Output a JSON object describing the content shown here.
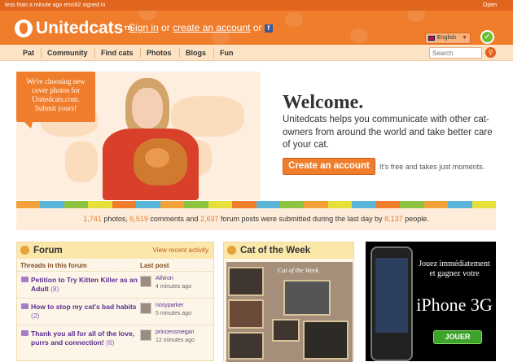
{
  "topstrip": {
    "status": "less than a minute ago",
    "user": "ems92",
    "signed": "signed in",
    "open": "Open"
  },
  "header": {
    "logo": "Unitedcats",
    "logo_tm": "TM",
    "signin": "Sign in",
    "or1": "or",
    "create": "create an account",
    "or2": "or",
    "language": "English"
  },
  "nav": {
    "items": [
      "Pat",
      "Community",
      "Find cats",
      "Photos",
      "Blogs",
      "Fun"
    ],
    "search_placeholder": "Search"
  },
  "hero": {
    "bubble": "We're choosing new cover photos for Unitedcats.com. Submit yours!",
    "welcome": "Welcome.",
    "intro": "Unitedcats helps you communicate with other cat-owners from around the world and take better care of your cat.",
    "cta": "Create an account",
    "cta_note": "It's free and takes just moments."
  },
  "stats": {
    "photos": "1,741",
    "photos_label": "photos,",
    "comments": "6,519",
    "comments_label": "comments and",
    "posts": "2,637",
    "posts_label": "forum posts were submitted during the last day by",
    "people": "8,137",
    "people_label": "people."
  },
  "forum": {
    "title": "Forum",
    "recent": "View recent activity",
    "col_threads": "Threads in this forum",
    "col_last": "Last post",
    "threads": [
      {
        "title": "Petition to Try Kitten Killer as an Adult",
        "count": "(8)",
        "user": "Alhiron",
        "time": "4 minutes ago"
      },
      {
        "title": "How to stop my cat's bad habits",
        "count": "(2)",
        "user": "nosyparker",
        "time": "5 minutes ago"
      },
      {
        "title": "Thank you all for all of the love, purrs and connection!",
        "count": "(6)",
        "user": "princessmegan",
        "time": "12 minutes ago"
      }
    ]
  },
  "cotw": {
    "title": "Cat of the Week",
    "board_label": "Cat of the Week"
  },
  "ad": {
    "line1": "Jouez immédiatement et gagnez votre",
    "line2": "iPhone 3G",
    "button": "JOUER"
  },
  "colors": {
    "brand": "#ef7d2c",
    "nav_bg": "#fce3c4",
    "link_purple": "#5b2b91",
    "stat_num": "#e57a2d"
  }
}
